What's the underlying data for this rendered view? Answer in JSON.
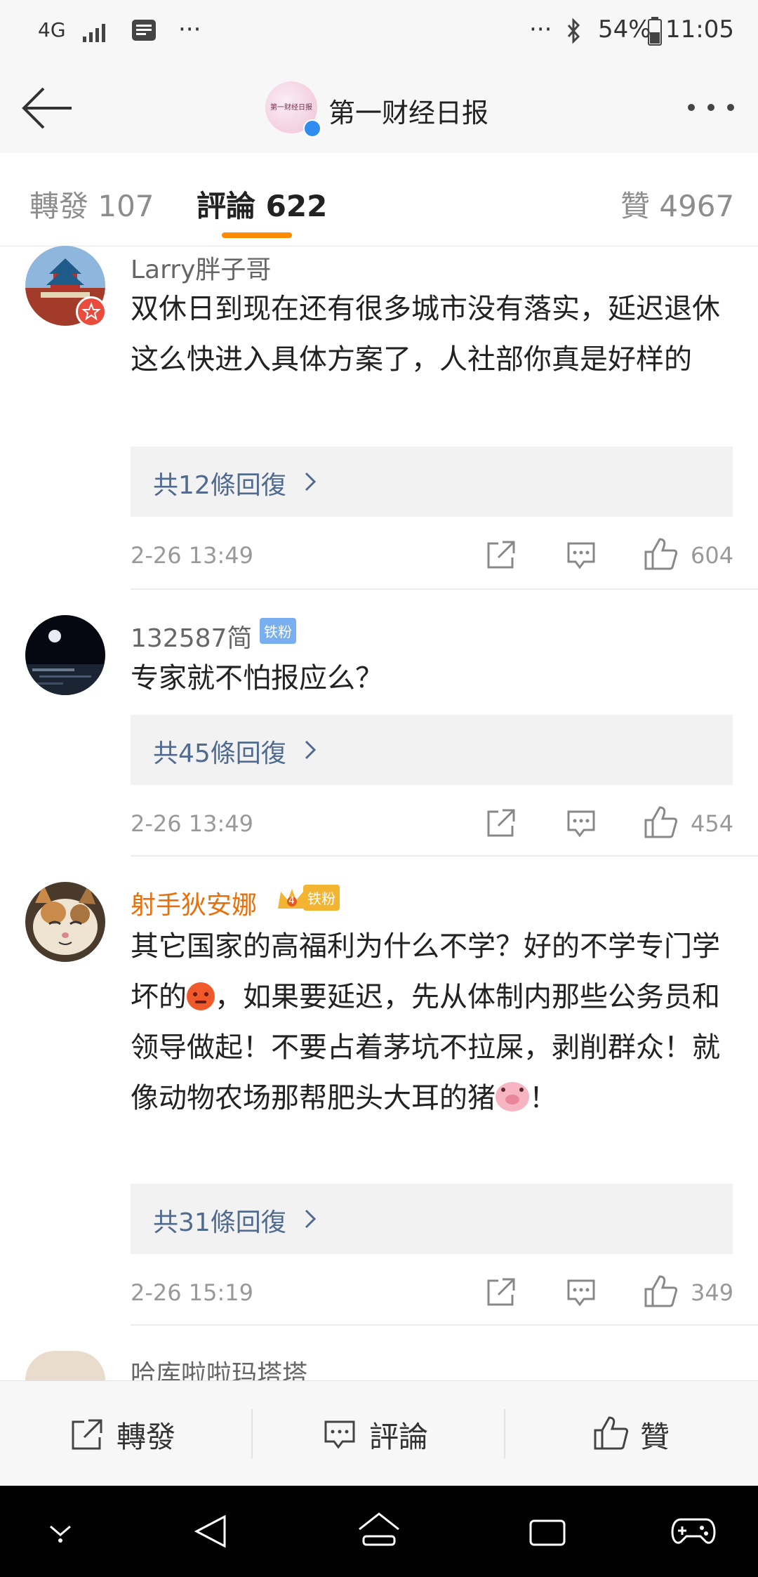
{
  "status_bar": {
    "network": "4G",
    "dots_left": "···",
    "dots_right": "···",
    "battery": "54%",
    "time": "11:05"
  },
  "nav": {
    "title": "第一财经日报",
    "avatar_text": "第一财经日报"
  },
  "tabs": {
    "repost": "轉發 107",
    "comments": "評論 622",
    "likes": "贊 4967"
  },
  "comments": [
    {
      "username": "Larry胖子哥",
      "content": "双休日到现在还有很多城市没有落实，延迟退休这么快进入具体方案了，人社部你真是好样的",
      "replies": "共12條回復",
      "time": "2-26 13:49",
      "likes": "604"
    },
    {
      "username": "132587简",
      "badge": "铁粉",
      "content": "专家就不怕报应么？",
      "replies": "共45條回復",
      "time": "2-26 13:49",
      "likes": "454"
    },
    {
      "username": "射手狄安娜",
      "badge": "铁粉",
      "vip_level": "4",
      "content_part1": "其它国家的高福利为什么不学？好的不学专门学坏的",
      "content_part2": "，如果要延迟，先从体制内那些公务员和领导做起！不要占着茅坑不拉屎，剥削群众！就像动物农场那帮肥头大耳的猪",
      "content_part3": "！",
      "replies": "共31條回復",
      "time": "2-26 15:19",
      "likes": "349"
    },
    {
      "username": "哈库啦啦玛塔塔"
    }
  ],
  "bottom_bar": {
    "repost": "轉發",
    "comment": "評論",
    "like": "贊"
  },
  "colors": {
    "accent": "#ff8a00",
    "reply_link": "#506b8f",
    "vip_username": "#e8700a"
  }
}
